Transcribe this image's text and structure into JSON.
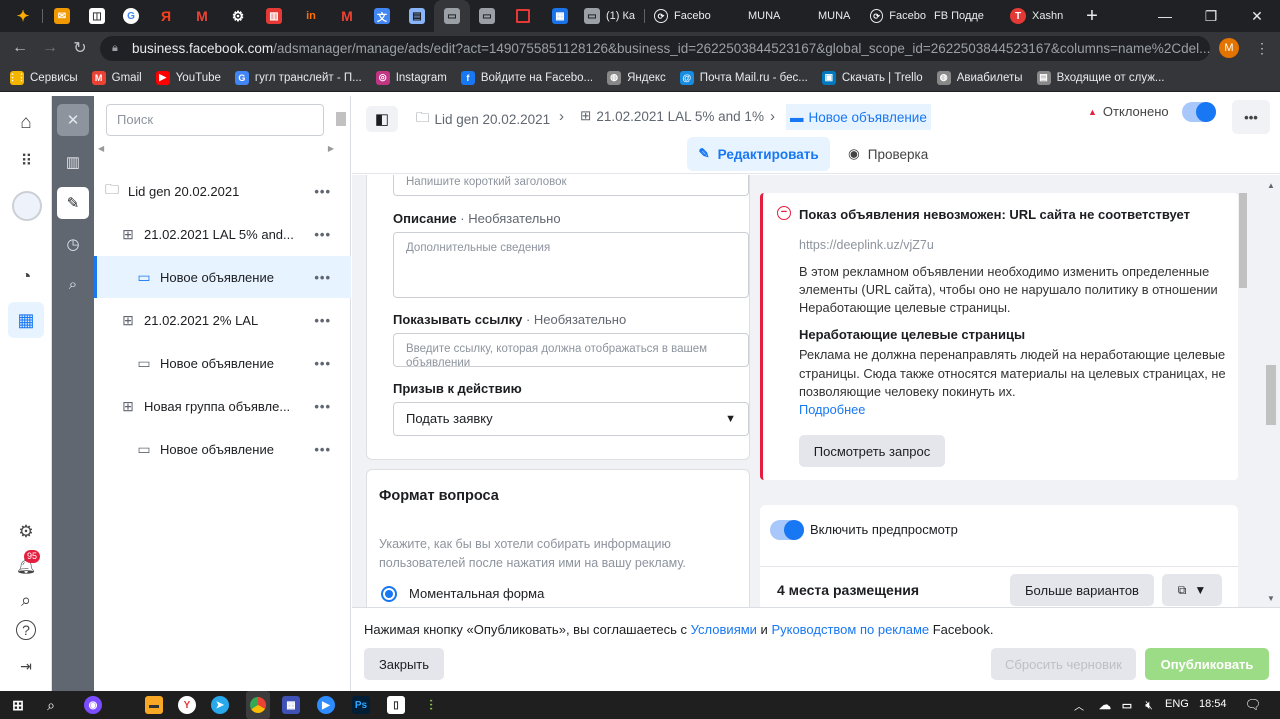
{
  "browser": {
    "tabs": [
      {
        "icon": "sparkle-tab-icon",
        "title": ""
      },
      {
        "icon": "mail-tab-icon",
        "title": ""
      },
      {
        "icon": "app-tab-icon",
        "title": ""
      },
      {
        "icon": "google-tab-icon",
        "title": ""
      },
      {
        "icon": "yandex-tab-icon",
        "title": ""
      },
      {
        "icon": "gmail-tab-icon",
        "title": ""
      },
      {
        "icon": "settings-tab-icon",
        "title": ""
      },
      {
        "icon": "trello-tab-icon",
        "title": ""
      },
      {
        "icon": "in-tab-icon",
        "title": "In"
      },
      {
        "icon": "gmail-tab-icon",
        "title": ""
      },
      {
        "icon": "translate-tab-icon",
        "title": ""
      },
      {
        "icon": "doc-tab-icon",
        "title": ""
      },
      {
        "icon": "page-tab-icon",
        "title": ""
      },
      {
        "icon": "page-tab-icon",
        "title": ""
      },
      {
        "icon": "square-tab-icon",
        "title": ""
      },
      {
        "icon": "calendar-tab-icon",
        "title": ""
      },
      {
        "icon": "page-tab-icon",
        "title": "(1) Ка"
      },
      {
        "icon": "loading-tab-icon",
        "title": "Facebo"
      },
      {
        "icon": "munа-tab-icon",
        "title": "MUNA"
      },
      {
        "icon": "munа-tab-icon",
        "title": "MUNA"
      },
      {
        "icon": "loading-tab-icon",
        "title": "Facebo"
      },
      {
        "icon": "fb-tab-icon",
        "title": "FB Подде"
      },
      {
        "icon": "t-tab-icon",
        "title": "Xashn"
      }
    ],
    "new_tab_glyph": "+",
    "url_host": "business.facebook.com",
    "url_rest": "/adsmanager/manage/ads/edit?act=1490755851128126&business_id=2622503844523167&global_scope_id=2622503844523167&columns=name%2Cdel...",
    "profile_initial": "M",
    "bookmarks": [
      {
        "label": "Сервисы",
        "color": "#f4b400",
        "glyph": "⋮⋮"
      },
      {
        "label": "Gmail",
        "color": "#ea4335",
        "glyph": "M"
      },
      {
        "label": "YouTube",
        "color": "#ff0000",
        "glyph": "▶"
      },
      {
        "label": "гугл транслейт - П...",
        "color": "#4285f4",
        "glyph": "G"
      },
      {
        "label": "Instagram",
        "color": "#c13584",
        "glyph": "◎"
      },
      {
        "label": "Войдите на Facebo...",
        "color": "#1877f2",
        "glyph": "f"
      },
      {
        "label": "Яндекс",
        "color": "#888888",
        "glyph": "◍"
      },
      {
        "label": "Почта Mail.ru - бес...",
        "color": "#168de2",
        "glyph": "@"
      },
      {
        "label": "Скачать | Trello",
        "color": "#0079bf",
        "glyph": "▣"
      },
      {
        "label": "Авиабилеты",
        "color": "#888888",
        "glyph": "◍"
      },
      {
        "label": "Входящие от служ...",
        "color": "#888888",
        "glyph": "▤"
      }
    ]
  },
  "tree": {
    "search_placeholder": "Поиск",
    "items": [
      {
        "label": "Lid gen 20.02.2021",
        "icon": "folder-icon",
        "level": 0
      },
      {
        "label": "21.02.2021 LAL 5% and...",
        "icon": "adset-icon",
        "level": 1
      },
      {
        "label": "Новое объявление",
        "icon": "ad-icon",
        "level": 2,
        "selected": true
      },
      {
        "label": "21.02.2021 2% LAL",
        "icon": "adset-icon",
        "level": 1
      },
      {
        "label": "Новое объявление",
        "icon": "ad-icon",
        "level": 2
      },
      {
        "label": "Новая группа объявле...",
        "icon": "adset-icon",
        "level": 1
      },
      {
        "label": "Новое объявление",
        "icon": "ad-icon",
        "level": 2
      }
    ],
    "more_glyph": "•••"
  },
  "header": {
    "crumb1": "Lid gen 20.02.2021",
    "crumb2": "21.02.2021 LAL 5% and 1%",
    "crumb3": "Новое объявление",
    "status": "Отклонено",
    "edit_label": "Редактировать",
    "review_label": "Проверка"
  },
  "form": {
    "headline_placeholder": "Напишите короткий заголовок",
    "description_label": "Описание",
    "optional": "· Необязательно",
    "description_placeholder": "Дополнительные сведения",
    "display_link_label": "Показывать ссылку",
    "display_link_placeholder": "Введите ссылку, которая должна отображаться в вашем объявлении",
    "cta_label": "Призыв к действию",
    "cta_value": "Подать заявку",
    "format_title": "Формат вопроса",
    "format_desc": "Укажите, как бы вы хотели собирать информацию пользователей после нажатия ими на вашу рекламу.",
    "radio_instant": "Моментальная форма"
  },
  "error": {
    "title": "Показ объявления невозможен: URL сайта не соответствует",
    "url": "https://deeplink.uz/vjZ7u",
    "body": "В этом рекламном объявлении необходимо изменить определенные элементы (URL сайта), чтобы оно не нарушало политику в отношении Неработающие целевые страницы.",
    "subtitle": "Неработающие целевые страницы",
    "sub_body": "Реклама не должна перенаправлять людей на неработающие целевые страницы. Сюда также относятся материалы на целевых страницах, не позволяющие человеку покинуть их.",
    "more_link": "Подробнее",
    "request_button": "Посмотреть запрос"
  },
  "preview": {
    "toggle_label": "Включить предпросмотр",
    "placements_label": "4 места размещения",
    "more_options": "Больше вариантов"
  },
  "footer": {
    "terms_prefix": "Нажимая кнопку «Опубликовать», вы соглашаетесь с ",
    "terms_link1": "Условиями",
    "terms_and": " и ",
    "terms_link2": "Руководством по рекламе",
    "terms_suffix": " Facebook.",
    "close_label": "Закрыть",
    "reset_label": "Сбросить черновик",
    "publish_label": "Опубликовать"
  },
  "taskbar": {
    "lang": "ENG",
    "time": "18:54"
  },
  "left_nav": {
    "notification_count": "95"
  },
  "colors": {
    "fb_blue": "#1877f2",
    "error_red": "#e41e3f",
    "publish_green": "#42b72a"
  }
}
